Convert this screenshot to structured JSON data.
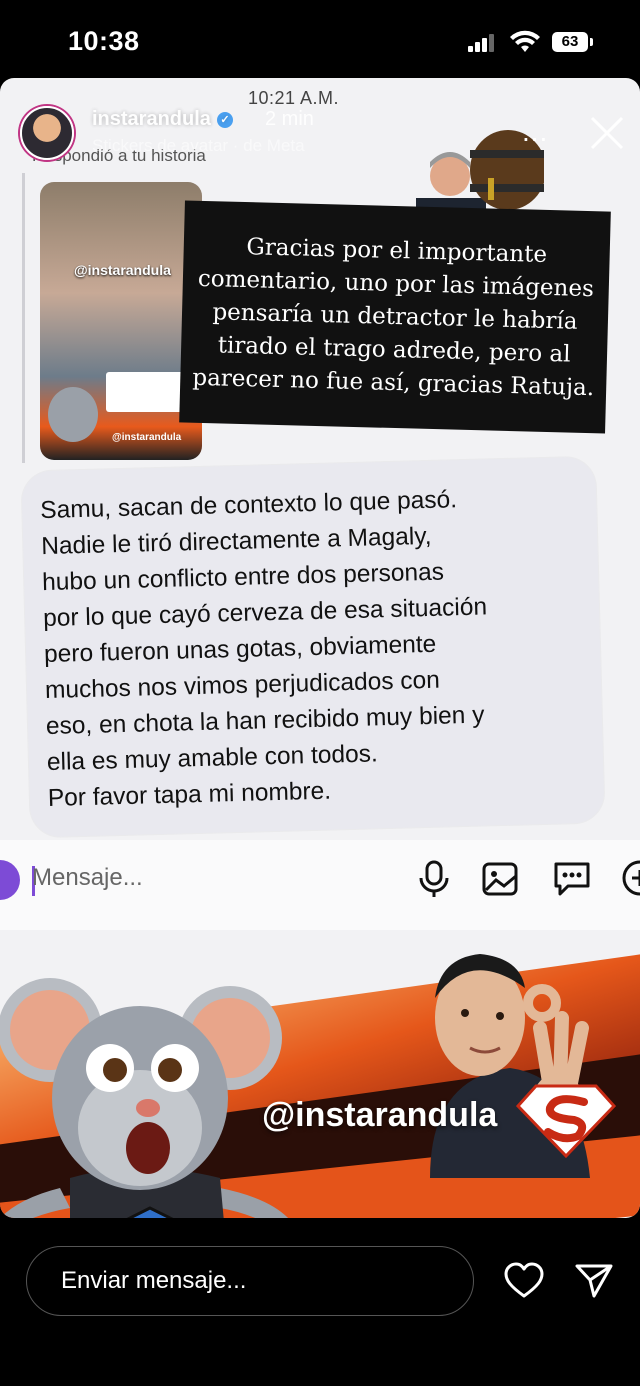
{
  "status_bar": {
    "time": "10:38",
    "battery": "63"
  },
  "story": {
    "username": "instarandula",
    "time_ago": "2 min",
    "sticker_line": "Stickers de avatar · de Meta",
    "more": "...",
    "dm_time": "10:21 A.M.",
    "replied": "Respondió a tu historia",
    "thumb_handle": "@instarandula",
    "thumb_handle_small": "@instarandula",
    "caption": "Gracias por el importante comentario, uno por las imágenes pensaría un detractor le habría tirado el trago adrede, pero al parecer no fue así, gracias Ratuja.",
    "message": "Samu, sacan de contexto lo que pasó.\nNadie le tiró directamente a Magaly,\nhubo un conflicto entre dos personas\npor lo que cayó cerveza de esa situación\npero fueron unas gotas, obviamente\nmuchos nos vimos perjudicados con\neso, en chota la han recibido muy bien y\nella es muy amable con todos.\nPor favor tapa mi nombre.",
    "composer_placeholder": "Mensaje...",
    "brand_handle": "@instarandula"
  },
  "reply": {
    "placeholder": "Enviar mensaje..."
  },
  "icons": [
    "signal-icon",
    "wifi-icon",
    "verified-icon",
    "close-icon",
    "mic-icon",
    "gallery-icon",
    "sticker-icon",
    "plus-icon",
    "heart-icon",
    "send-icon"
  ],
  "colors": {
    "background": "#000000",
    "card": "#f2f2f4",
    "bubble": "#e9e9ef",
    "brand_orange": "#e5571a",
    "accent_purple": "#7d4bd6"
  }
}
